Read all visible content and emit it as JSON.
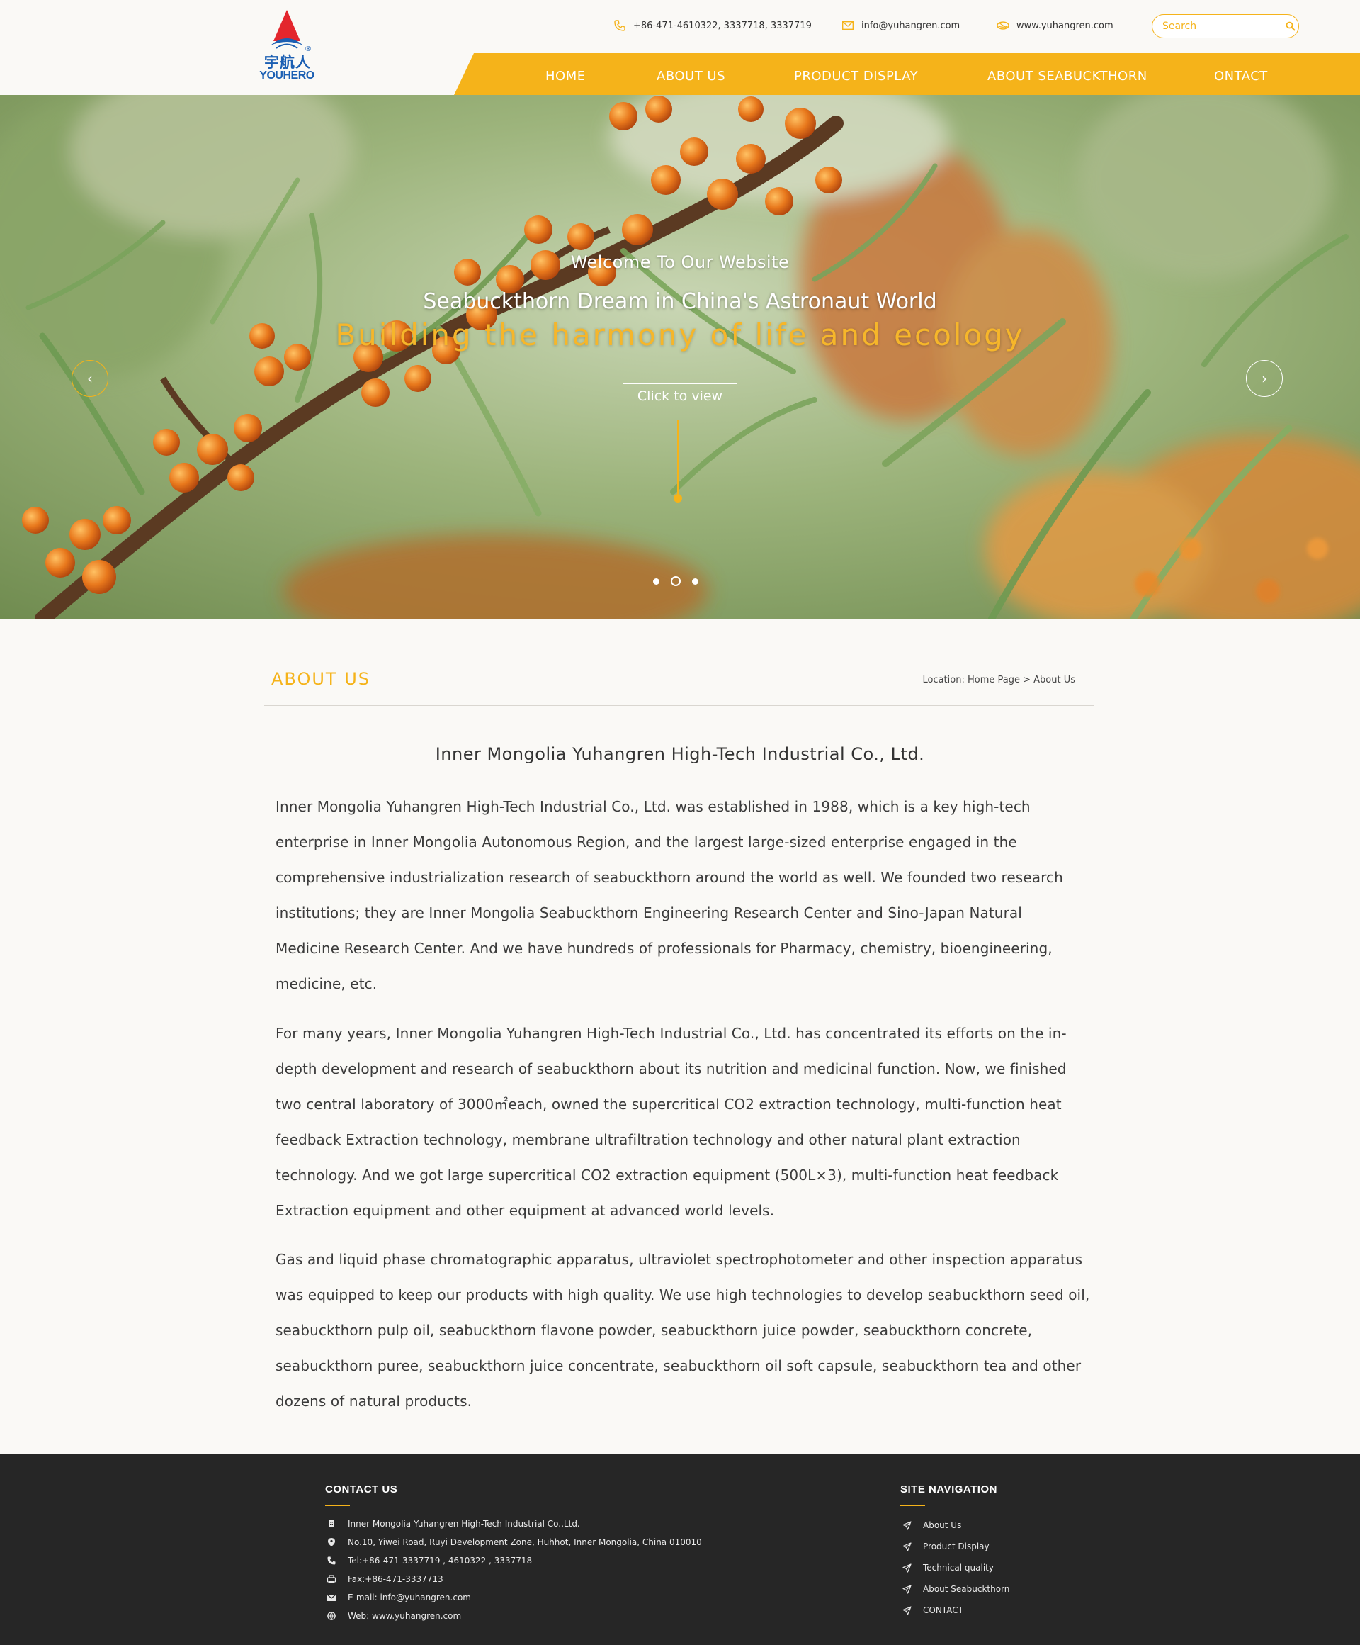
{
  "header": {
    "logo": {
      "cn": "宇航人",
      "en": "YOUHERO",
      "reg": "®"
    },
    "phone": "+86-471-4610322,   3337718,   3337719",
    "email": "info@yuhangren.com",
    "website": "www.yuhangren.com",
    "search_placeholder": "Search"
  },
  "nav": {
    "items": [
      "HOME",
      "ABOUT US",
      "PRODUCT DISPLAY",
      "ABOUT SEABUCKTHORN",
      "ONTACT"
    ]
  },
  "hero": {
    "welcome": "Welcome To Our Website",
    "title": "Seabuckthorn Dream in China's Astronaut World",
    "tagline": "Building the harmony of life and ecology",
    "button": "Click to view",
    "prev": "‹",
    "next": "›",
    "slide_count": 3,
    "active_slide": 2
  },
  "about": {
    "title": "ABOUT  US",
    "location_label": "Location: ",
    "crumb_home": "Home Page",
    "crumb_sep": " > ",
    "crumb_current": "About Us",
    "company": "Inner Mongolia Yuhangren High-Tech Industrial Co., Ltd.",
    "paragraphs": [
      "Inner Mongolia Yuhangren High-Tech Industrial Co., Ltd. was established in 1988, which is a key high-tech enterprise in Inner Mongolia Autonomous Region, and the largest large-sized enterprise engaged in the comprehensive industrialization research of seabuckthorn around the world as well. We founded two research institutions; they are Inner Mongolia Seabuckthorn Engineering Research Center and Sino-Japan Natural Medicine Research Center. And we have hundreds of professionals for Pharmacy, chemistry, bioengineering, medicine, etc.",
      "For many years, Inner Mongolia Yuhangren High-Tech Industrial Co., Ltd. has concentrated its efforts on the in-depth development and research of seabuckthorn about its nutrition and medicinal function. Now, we finished two central laboratory of 3000㎡each, owned the supercritical CO2 extraction technology, multi-function heat feedback Extraction technology, membrane ultrafiltration technology and other natural plant extraction technology. And we got large supercritical CO2 extraction equipment (500L×3), multi-function heat feedback Extraction equipment and other equipment at advanced world levels.",
      "Gas and liquid phase chromatographic apparatus, ultraviolet spectrophotometer and other inspection apparatus was equipped to keep our products with high quality. We use high technologies to develop seabuckthorn seed oil, seabuckthorn pulp oil, seabuckthorn flavone powder, seabuckthorn juice powder, seabuckthorn concrete, seabuckthorn puree, seabuckthorn juice concentrate, seabuckthorn oil soft capsule, seabuckthorn tea and other dozens of natural products."
    ]
  },
  "footer": {
    "contact_title": "CONTACT US",
    "contact": [
      {
        "icon": "building-icon",
        "text": "Inner Mongolia Yuhangren High-Tech Industrial Co.,Ltd."
      },
      {
        "icon": "location-pin-icon",
        "text": "No.10, Yiwei Road, Ruyi Development Zone, Huhhot, Inner Mongolia, China 010010"
      },
      {
        "icon": "phone-icon",
        "text": "Tel:+86-471-3337719 , 4610322 , 3337718"
      },
      {
        "icon": "fax-icon",
        "text": "Fax:+86-471-3337713"
      },
      {
        "icon": "mail-icon",
        "text": "E-mail: info@yuhangren.com"
      },
      {
        "icon": "globe-icon",
        "text": "Web: www.yuhangren.com"
      }
    ],
    "nav_title": "SITE NAVIGATION",
    "nav": [
      "About Us",
      "Product Display",
      "Technical quality",
      "About Seabuckthorn",
      "CONTACT"
    ]
  },
  "colors": {
    "accent": "#f5b31a",
    "footer_bg": "#262626",
    "logo_blue": "#1b5fb3",
    "logo_red": "#e3262d"
  }
}
